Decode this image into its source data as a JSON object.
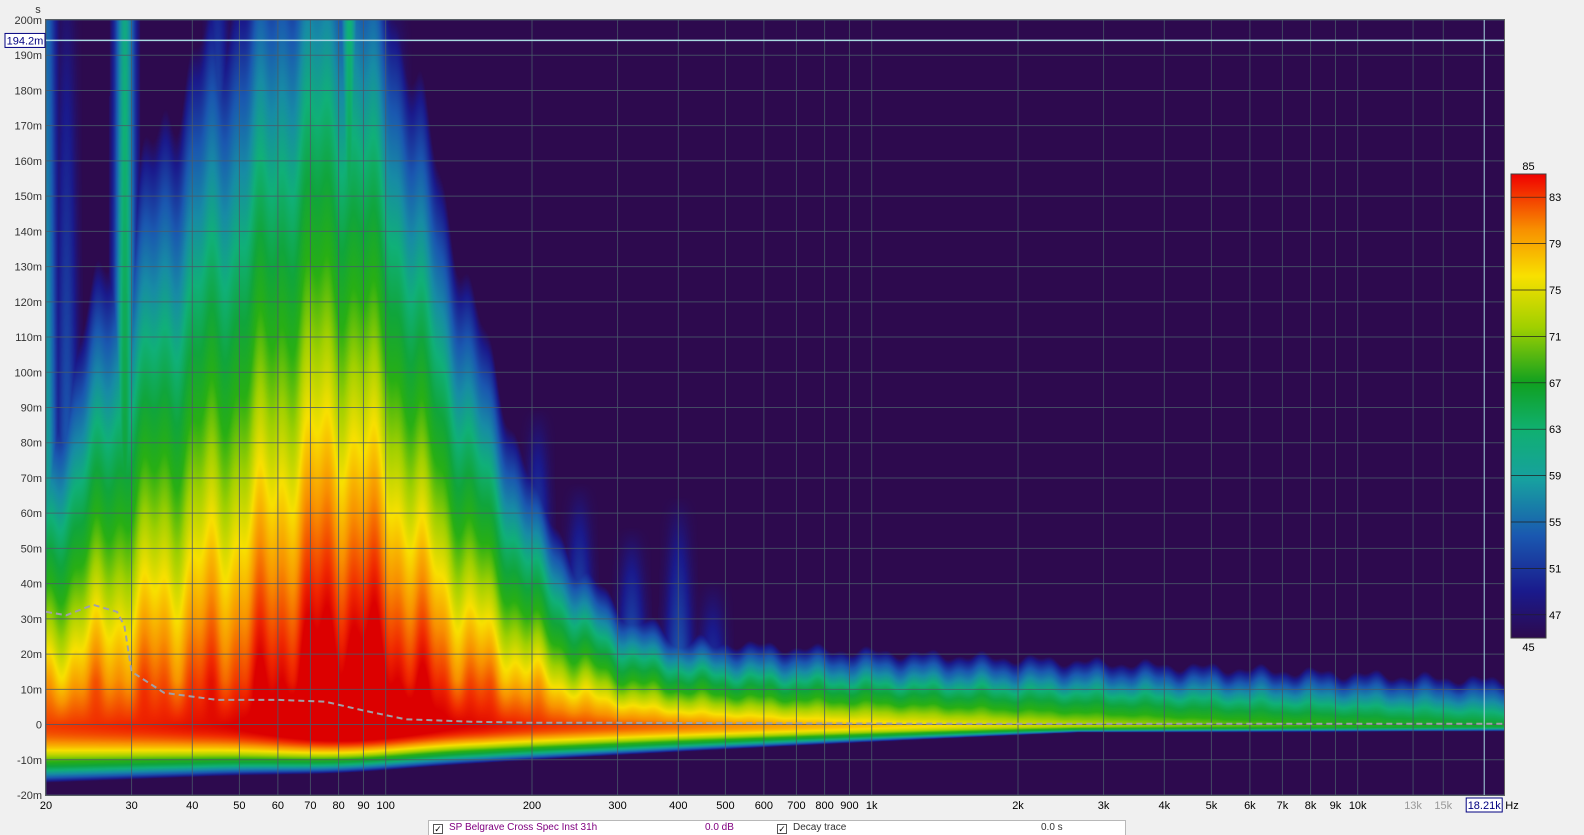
{
  "chart_data": {
    "type": "heatmap",
    "title": "",
    "xlabel": "",
    "ylabel": "s",
    "x_unit_label": "Hz",
    "x_scale": "log",
    "xlim": [
      20,
      20000
    ],
    "ylim": [
      -0.02,
      0.2
    ],
    "x_ticks": [
      {
        "value": 20,
        "label": "20"
      },
      {
        "value": 30,
        "label": "30"
      },
      {
        "value": 40,
        "label": "40"
      },
      {
        "value": 50,
        "label": "50"
      },
      {
        "value": 60,
        "label": "60"
      },
      {
        "value": 70,
        "label": "70"
      },
      {
        "value": 80,
        "label": "80"
      },
      {
        "value": 90,
        "label": "90"
      },
      {
        "value": 100,
        "label": "100"
      },
      {
        "value": 200,
        "label": "200"
      },
      {
        "value": 300,
        "label": "300"
      },
      {
        "value": 400,
        "label": "400"
      },
      {
        "value": 500,
        "label": "500"
      },
      {
        "value": 600,
        "label": "600"
      },
      {
        "value": 700,
        "label": "700"
      },
      {
        "value": 800,
        "label": "800"
      },
      {
        "value": 900,
        "label": "900"
      },
      {
        "value": 1000,
        "label": "1k"
      },
      {
        "value": 2000,
        "label": "2k"
      },
      {
        "value": 3000,
        "label": "3k"
      },
      {
        "value": 4000,
        "label": "4k"
      },
      {
        "value": 5000,
        "label": "5k"
      },
      {
        "value": 6000,
        "label": "6k"
      },
      {
        "value": 7000,
        "label": "7k"
      },
      {
        "value": 8000,
        "label": "8k"
      },
      {
        "value": 9000,
        "label": "9k"
      },
      {
        "value": 10000,
        "label": "10k"
      },
      {
        "value": 13000,
        "label": "13k",
        "dim": true
      },
      {
        "value": 15000,
        "label": "15k",
        "dim": true
      }
    ],
    "y_ticks": [
      {
        "value": 0.2,
        "label": "200m"
      },
      {
        "value": 0.19,
        "label": "190m"
      },
      {
        "value": 0.18,
        "label": "180m"
      },
      {
        "value": 0.17,
        "label": "170m"
      },
      {
        "value": 0.16,
        "label": "160m"
      },
      {
        "value": 0.15,
        "label": "150m"
      },
      {
        "value": 0.14,
        "label": "140m"
      },
      {
        "value": 0.13,
        "label": "130m"
      },
      {
        "value": 0.12,
        "label": "120m"
      },
      {
        "value": 0.11,
        "label": "110m"
      },
      {
        "value": 0.1,
        "label": "100m"
      },
      {
        "value": 0.09,
        "label": "90m"
      },
      {
        "value": 0.08,
        "label": "80m"
      },
      {
        "value": 0.07,
        "label": "70m"
      },
      {
        "value": 0.06,
        "label": "60m"
      },
      {
        "value": 0.05,
        "label": "50m"
      },
      {
        "value": 0.04,
        "label": "40m"
      },
      {
        "value": 0.03,
        "label": "30m"
      },
      {
        "value": 0.02,
        "label": "20m"
      },
      {
        "value": 0.01,
        "label": "10m"
      },
      {
        "value": 0,
        "label": "0"
      },
      {
        "value": -0.01,
        "label": "-10m"
      },
      {
        "value": -0.02,
        "label": "-20m"
      }
    ],
    "cursor": {
      "time": 0.1942,
      "time_label": "194.2m",
      "freq": 18210,
      "freq_label": "18.21k"
    },
    "colorbar": {
      "min": 45,
      "max": 85,
      "min_label": "45",
      "max_label": "85",
      "ticks": [
        {
          "value": 83,
          "label": "83"
        },
        {
          "value": 79,
          "label": "79"
        },
        {
          "value": 75,
          "label": "75"
        },
        {
          "value": 71,
          "label": "71"
        },
        {
          "value": 67,
          "label": "67"
        },
        {
          "value": 63,
          "label": "63"
        },
        {
          "value": 59,
          "label": "59"
        },
        {
          "value": 55,
          "label": "55"
        },
        {
          "value": 51,
          "label": "51"
        },
        {
          "value": 47,
          "label": "47"
        }
      ]
    },
    "ridges": [
      {
        "f": 20,
        "level": 60,
        "decay": 0.2
      },
      {
        "f": 22,
        "level": 54,
        "decay": 0.2
      },
      {
        "f": 29,
        "level": 66,
        "decay": 0.2
      },
      {
        "f": 34,
        "level": 50,
        "decay": 0.2
      },
      {
        "f": 38,
        "level": 52,
        "decay": 0.16
      },
      {
        "f": 45,
        "level": 64,
        "decay": 0.1
      },
      {
        "f": 55,
        "level": 58,
        "decay": 0.13
      },
      {
        "f": 62,
        "level": 60,
        "decay": 0.12
      },
      {
        "f": 70,
        "level": 62,
        "decay": 0.1
      },
      {
        "f": 76,
        "level": 64,
        "decay": 0.13
      },
      {
        "f": 84,
        "level": 68,
        "decay": 0.18
      },
      {
        "f": 95,
        "level": 64,
        "decay": 0.13
      },
      {
        "f": 105,
        "level": 60,
        "decay": 0.11
      },
      {
        "f": 120,
        "level": 58,
        "decay": 0.08
      },
      {
        "f": 145,
        "level": 59,
        "decay": 0.06
      },
      {
        "f": 175,
        "level": 56,
        "decay": 0.05
      },
      {
        "f": 205,
        "level": 57,
        "decay": 0.06
      },
      {
        "f": 250,
        "level": 55,
        "decay": 0.055
      },
      {
        "f": 320,
        "level": 54,
        "decay": 0.05
      },
      {
        "f": 400,
        "level": 53,
        "decay": 0.065
      },
      {
        "f": 470,
        "level": 51,
        "decay": 0.055
      },
      {
        "f": 560,
        "level": 50,
        "decay": 0.03
      },
      {
        "f": 680,
        "level": 50,
        "decay": 0.025
      },
      {
        "f": 860,
        "level": 49,
        "decay": 0.02
      },
      {
        "f": 1400,
        "level": 48,
        "decay": 0.012
      }
    ],
    "overlay_curve": {
      "label": "dashed decay reference",
      "freq": [
        20,
        22,
        25,
        28,
        29,
        30,
        35,
        45,
        60,
        75,
        90,
        110,
        150,
        200,
        300,
        500,
        1000,
        2000,
        5000,
        10000,
        20000
      ],
      "time": [
        0.032,
        0.031,
        0.034,
        0.032,
        0.028,
        0.015,
        0.009,
        0.007,
        0.007,
        0.0065,
        0.004,
        0.0015,
        0.0008,
        0.0005,
        0.0005,
        0.0004,
        0.0003,
        0.0002,
        0.0002,
        0.0002,
        0.0002
      ]
    }
  },
  "legend_strip": {
    "item1": "SP Belgrave Cross Spec Inst 31h",
    "item1_value": "0.0 dB",
    "item2": "Decay trace",
    "item2_value": "0.0 s"
  },
  "colors": {
    "background_plot": "#2d0a4e",
    "grid": "#4a5a6a",
    "cursor": "#a8d8e0",
    "curve": "#a0a0a8"
  }
}
